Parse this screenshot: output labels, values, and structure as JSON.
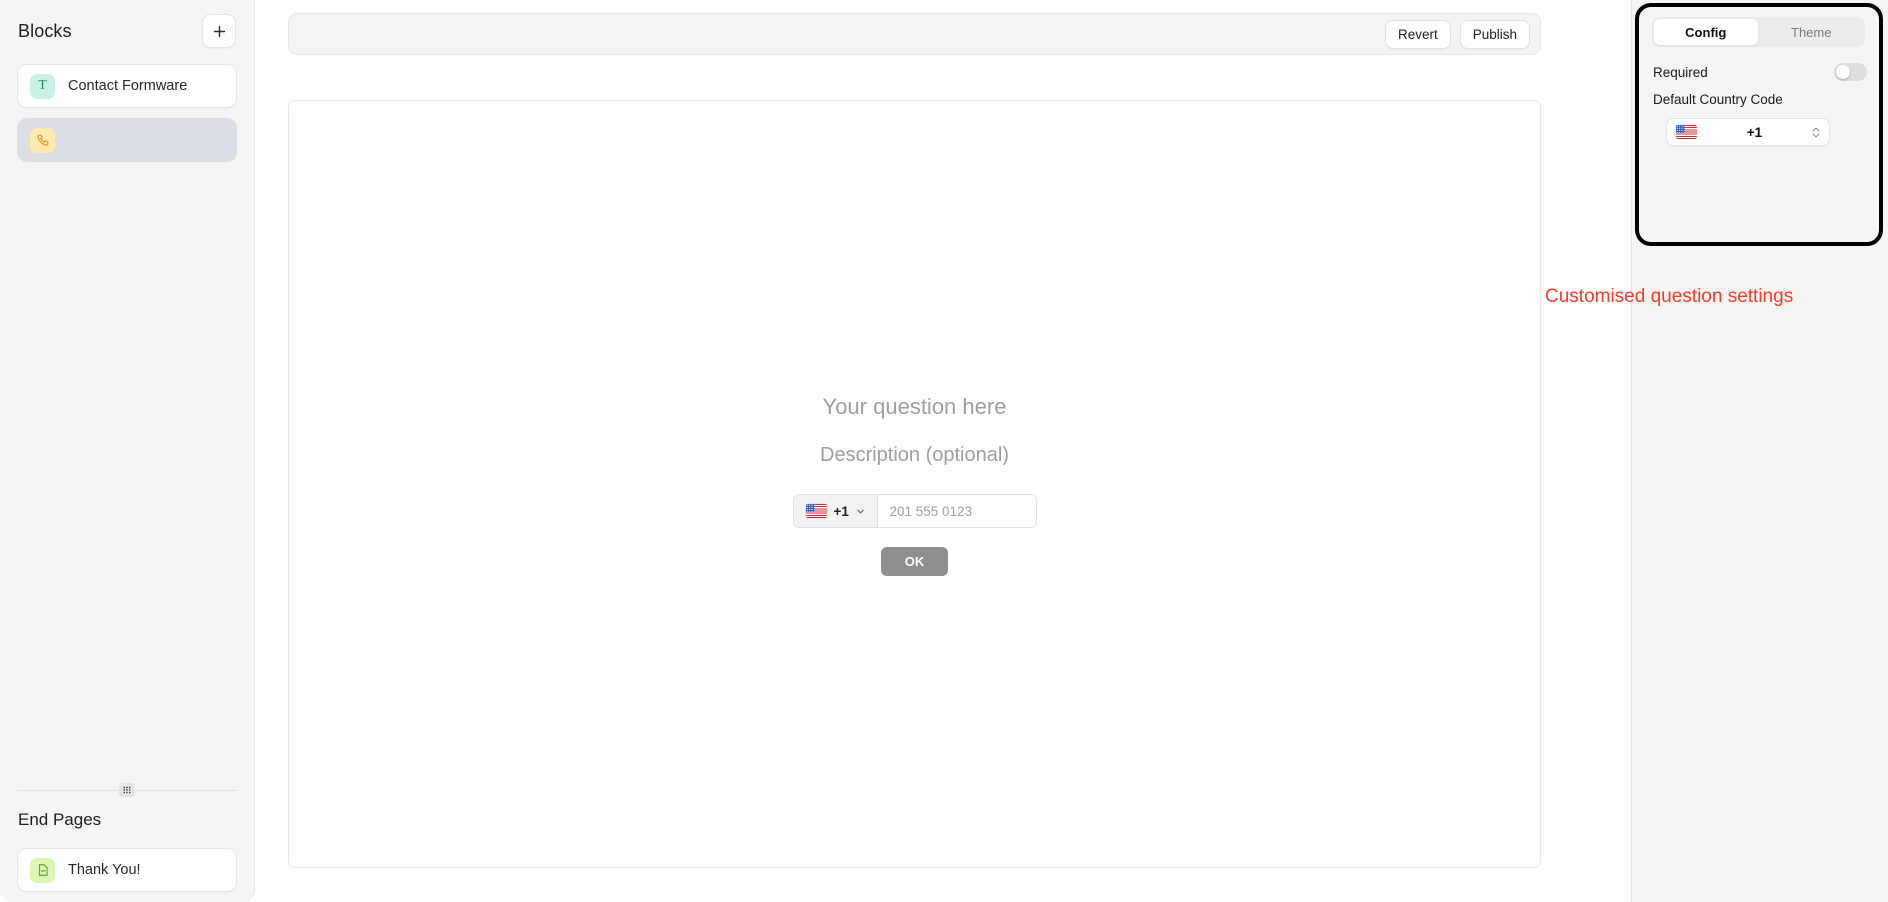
{
  "sidebar": {
    "title": "Blocks",
    "add_button_label": "+",
    "blocks": [
      {
        "label": "Contact Formware",
        "icon": "text-block-icon",
        "glyph": "T",
        "selected": false
      },
      {
        "label": "",
        "icon": "phone-block-icon",
        "glyph": "",
        "selected": true
      }
    ],
    "end_pages_title": "End Pages",
    "end_pages": [
      {
        "label": "Thank You!",
        "icon": "end-page-icon"
      }
    ],
    "drag_handle": "resize-handle"
  },
  "toolbar": {
    "revert_label": "Revert",
    "publish_label": "Publish"
  },
  "canvas": {
    "question_title": "Your question here",
    "question_description": "Description (optional)",
    "phone_field": {
      "country_code": "+1",
      "flag": "us-flag-icon",
      "placeholder": "201 555 0123",
      "value": ""
    },
    "submit_label": "OK"
  },
  "config_panel": {
    "tabs": [
      {
        "label": "Config",
        "active": true
      },
      {
        "label": "Theme",
        "active": false
      }
    ],
    "required_label": "Required",
    "required_value": "off",
    "default_country_code_label": "Default Country Code",
    "default_country_code_value": "+1",
    "default_country_flag": "us-flag-icon"
  },
  "annotation": {
    "text": "Customised question settings",
    "color": "#fa3a24"
  },
  "colors": {
    "sidebar_bg": "#f5f5f3",
    "selected_block": "#dcdee6",
    "text_icon_bg": "#c7f2e3",
    "text_icon_fg": "#178a6e",
    "phone_icon_bg": "#ffe9ac",
    "phone_icon_fg": "#e8922a",
    "end_icon_bg": "#dcf5b4",
    "end_icon_fg": "#62a82a",
    "submit_bg": "#8e8e8e",
    "placeholder": "#9aa0a6"
  }
}
